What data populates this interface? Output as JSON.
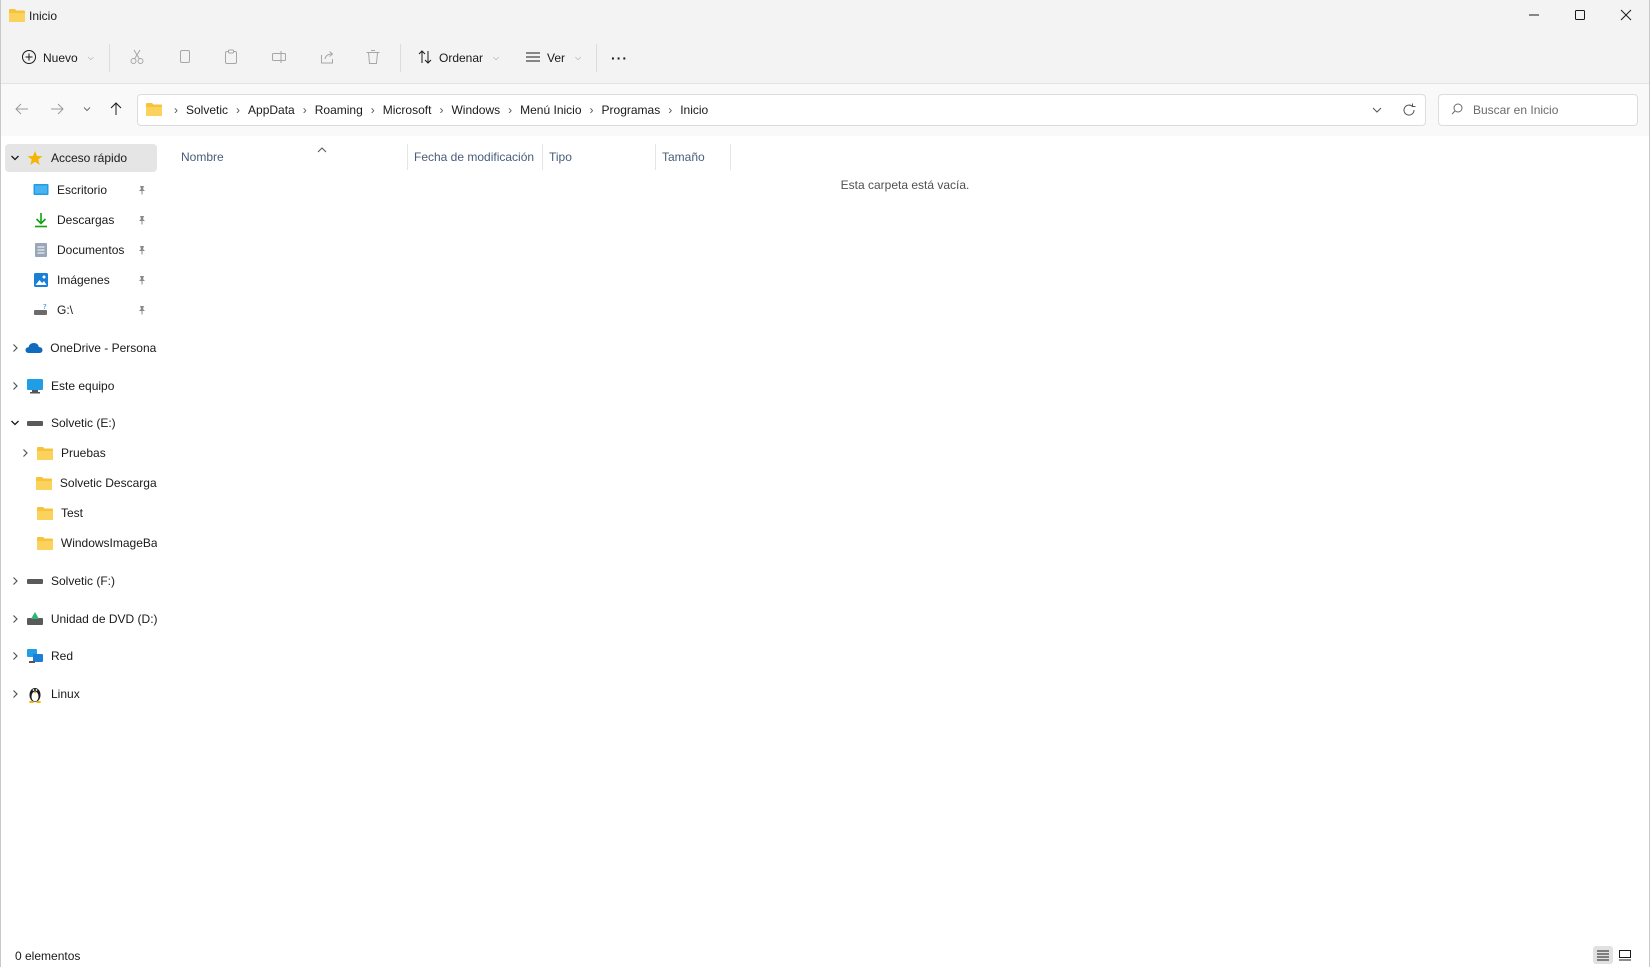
{
  "window": {
    "title": "Inicio"
  },
  "commandbar": {
    "new_label": "Nuevo",
    "sort_label": "Ordenar",
    "view_label": "Ver",
    "more_label": "···"
  },
  "address": {
    "crumbs": [
      "Solvetic",
      "AppData",
      "Roaming",
      "Microsoft",
      "Windows",
      "Menú Inicio",
      "Programas",
      "Inicio"
    ]
  },
  "search": {
    "placeholder": "Buscar en Inicio"
  },
  "sidebar": {
    "quick_access": {
      "label": "Acceso rápido",
      "items": [
        {
          "label": "Escritorio",
          "icon": "desktop-icon"
        },
        {
          "label": "Descargas",
          "icon": "download-icon"
        },
        {
          "label": "Documentos",
          "icon": "document-icon"
        },
        {
          "label": "Imágenes",
          "icon": "image-icon"
        },
        {
          "label": "G:\\",
          "icon": "network-drive-icon"
        }
      ]
    },
    "onedrive": "OneDrive - Personal",
    "this_pc": "Este equipo",
    "drive_e": {
      "label": "Solvetic (E:)",
      "folders": [
        "Pruebas",
        "Solvetic Descargas",
        "Test",
        "WindowsImageBa"
      ]
    },
    "drive_f": "Solvetic (F:)",
    "dvd": "Unidad de DVD (D:)",
    "network": "Red",
    "linux": "Linux"
  },
  "content": {
    "columns": [
      "Nombre",
      "Fecha de modificación",
      "Tipo",
      "Tamaño"
    ],
    "empty_message": "Esta carpeta está vacía."
  },
  "status": {
    "items_count": "0 elementos"
  },
  "colors": {
    "folder_yellow": "#f8c33c",
    "accent_blue": "#0078d4",
    "star": "#f5b400"
  }
}
